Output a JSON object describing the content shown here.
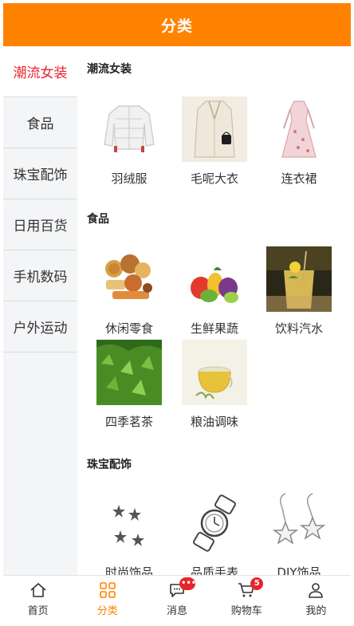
{
  "header": {
    "title": "分类"
  },
  "sidebar": {
    "items": [
      {
        "label": "潮流女装"
      },
      {
        "label": "食品"
      },
      {
        "label": "珠宝配饰"
      },
      {
        "label": "日用百货"
      },
      {
        "label": "手机数码"
      },
      {
        "label": "户外运动"
      }
    ]
  },
  "sections": [
    {
      "title": "潮流女装",
      "products": [
        "羽绒服",
        "毛呢大衣",
        "连衣裙"
      ]
    },
    {
      "title": "食品",
      "products": [
        "休闲零食",
        "生鲜果蔬",
        "饮料汽水",
        "四季茗茶",
        "粮油调味"
      ]
    },
    {
      "title": "珠宝配饰",
      "products": [
        "时尚饰品",
        "品质手表",
        "DIY饰品"
      ]
    }
  ],
  "tabbar": {
    "tabs": [
      {
        "label": "首页",
        "icon": "home-icon"
      },
      {
        "label": "分类",
        "icon": "category-icon"
      },
      {
        "label": "消息",
        "icon": "message-icon",
        "badge": "•••"
      },
      {
        "label": "购物车",
        "icon": "cart-icon",
        "badge": "5"
      },
      {
        "label": "我的",
        "icon": "user-icon"
      }
    ]
  },
  "colors": {
    "accent": "#ff8200",
    "active_text": "#e8242b",
    "badge": "#e8242b"
  }
}
